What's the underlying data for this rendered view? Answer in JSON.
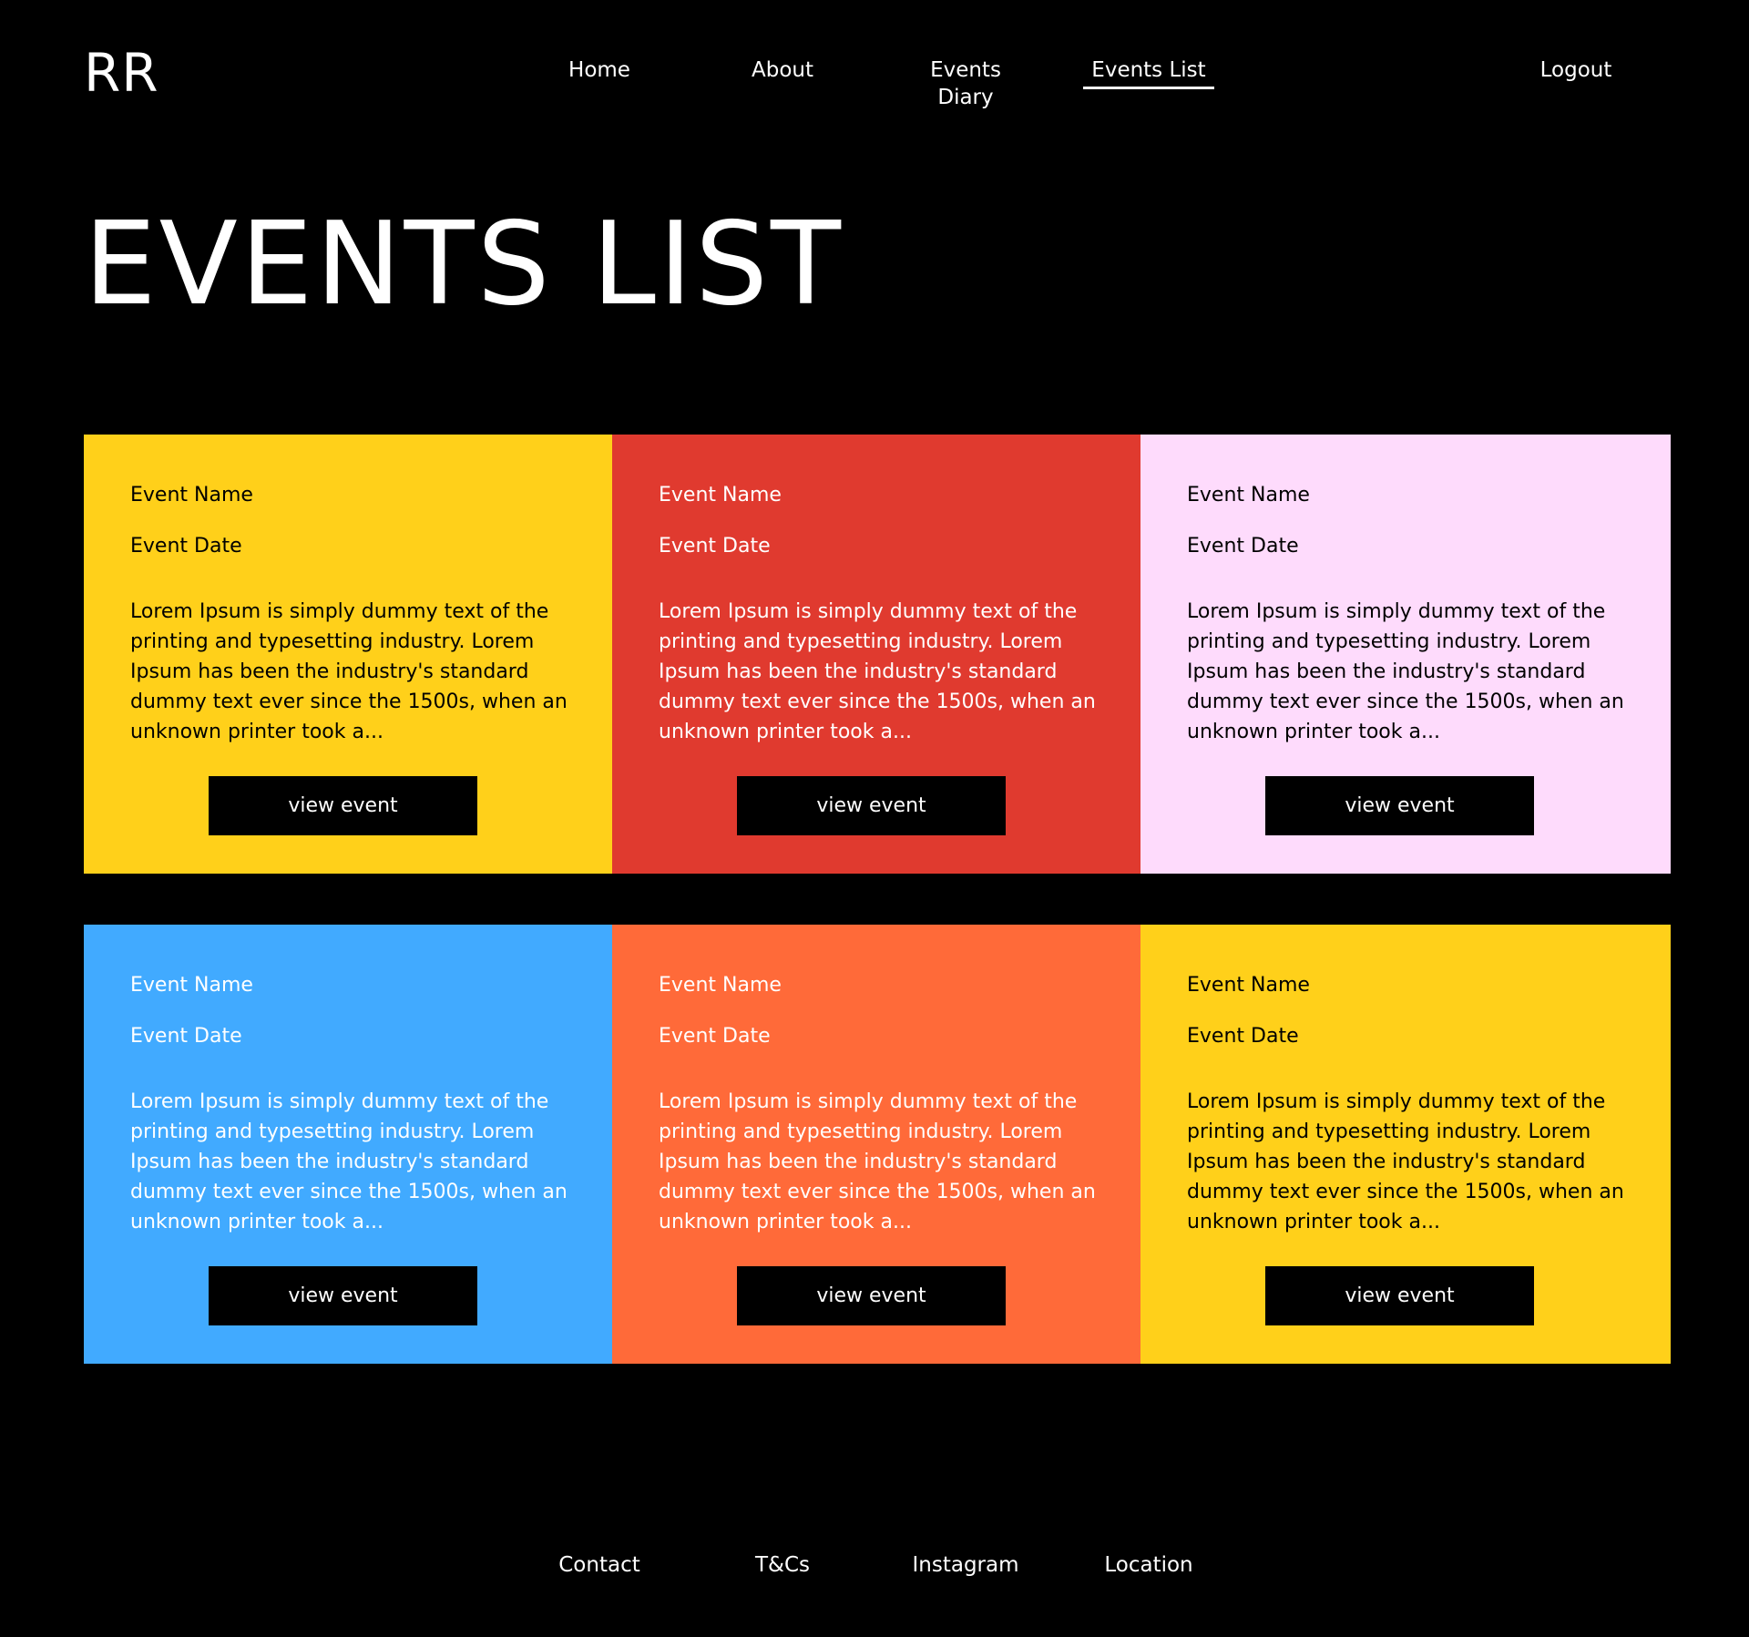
{
  "header": {
    "logo": "RR",
    "nav": [
      {
        "label": "Home",
        "active": false
      },
      {
        "label": "About",
        "active": false
      },
      {
        "label": "Events Diary",
        "active": false
      },
      {
        "label": "Events List",
        "active": true
      }
    ],
    "logout_label": "Logout"
  },
  "page": {
    "title": "EVENTS LIST"
  },
  "events": [
    {
      "name": "Event Name",
      "date": "Event Date",
      "description": "Lorem Ipsum is simply dummy text of the printing and typesetting industry. Lorem Ipsum has been the industry's standard dummy text ever since the 1500s, when an unknown printer took a...",
      "button_label": "view event",
      "bg_color": "#FFD01A",
      "text_color": "#000000"
    },
    {
      "name": "Event Name",
      "date": "Event Date",
      "description": "Lorem Ipsum is simply dummy text of the printing and typesetting industry. Lorem Ipsum has been the industry's standard dummy text ever since the 1500s, when an unknown printer took a...",
      "button_label": "view event",
      "bg_color": "#E03A2F",
      "text_color": "#FFFFFF"
    },
    {
      "name": "Event Name",
      "date": "Event Date",
      "description": "Lorem Ipsum is simply dummy text of the printing and typesetting industry. Lorem Ipsum has been the industry's standard dummy text ever since the 1500s, when an unknown printer took a...",
      "button_label": "view event",
      "bg_color": "#FEDBFC",
      "text_color": "#000000"
    },
    {
      "name": "Event Name",
      "date": "Event Date",
      "description": "Lorem Ipsum is simply dummy text of the printing and typesetting industry. Lorem Ipsum has been the industry's standard dummy text ever since the 1500s, when an unknown printer took a...",
      "button_label": "view event",
      "bg_color": "#41AAFF",
      "text_color": "#FFFFFF"
    },
    {
      "name": "Event Name",
      "date": "Event Date",
      "description": "Lorem Ipsum is simply dummy text of the printing and typesetting industry. Lorem Ipsum has been the industry's standard dummy text ever since the 1500s, when an unknown printer took a...",
      "button_label": "view event",
      "bg_color": "#FF6A39",
      "text_color": "#FFFFFF"
    },
    {
      "name": "Event Name",
      "date": "Event Date",
      "description": "Lorem Ipsum is simply dummy text of the printing and typesetting industry. Lorem Ipsum has been the industry's standard dummy text ever since the 1500s, when an unknown printer took a...",
      "button_label": "view event",
      "bg_color": "#FFD01A",
      "text_color": "#000000"
    }
  ],
  "footer": {
    "links": [
      "Contact",
      "T&Cs",
      "Instagram",
      "Location"
    ]
  },
  "colors": {
    "page_bg": "#000000",
    "button_bg": "#000000",
    "text_light": "#FFFFFF"
  }
}
